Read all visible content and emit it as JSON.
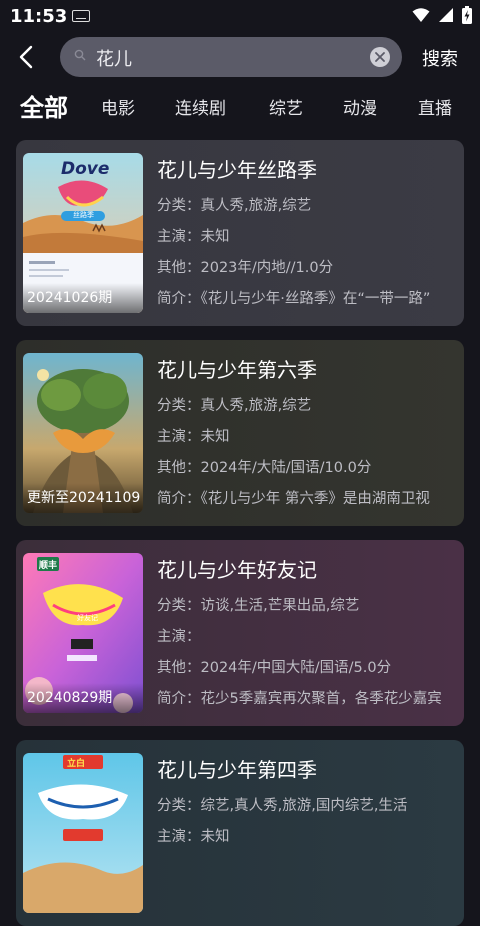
{
  "status": {
    "time": "11:53"
  },
  "search": {
    "query": "花儿",
    "button": "搜索"
  },
  "tabs": [
    "全部",
    "电影",
    "连续剧",
    "综艺",
    "动漫",
    "直播"
  ],
  "results": [
    {
      "title": "花儿与少年丝路季",
      "category": "分类：真人秀,旅游,综艺",
      "cast": "主演：未知",
      "other": "其他：2023年/内地//1.0分",
      "intro": "简介：《花儿与少年·丝路季》在“一带一路”",
      "badge": "20241026期",
      "poster_logo": "Dove",
      "poster_sub": "丝路季"
    },
    {
      "title": "花儿与少年第六季",
      "category": "分类：真人秀,旅游,综艺",
      "cast": "主演：未知",
      "other": "其他：2024年/大陆/国语/10.0分",
      "intro": "简介：《花儿与少年 第六季》是由湖南卫视",
      "badge": "更新至20241109",
      "poster_logo": "",
      "poster_sub": ""
    },
    {
      "title": "花儿与少年好友记",
      "category": "分类：访谈,生活,芒果出品,综艺",
      "cast": "主演：",
      "other": "其他：2024年/中国大陆/国语/5.0分",
      "intro": "简介：花少5季嘉宾再次聚首，各季花少嘉宾",
      "badge": "20240829期",
      "poster_logo": "顺丰",
      "poster_sub": "好友记"
    },
    {
      "title": "花儿与少年第四季",
      "category": "分类：综艺,真人秀,旅游,国内综艺,生活",
      "cast": "主演：未知",
      "other": "",
      "intro": "",
      "badge": "",
      "poster_logo": "立白",
      "poster_sub": ""
    }
  ]
}
